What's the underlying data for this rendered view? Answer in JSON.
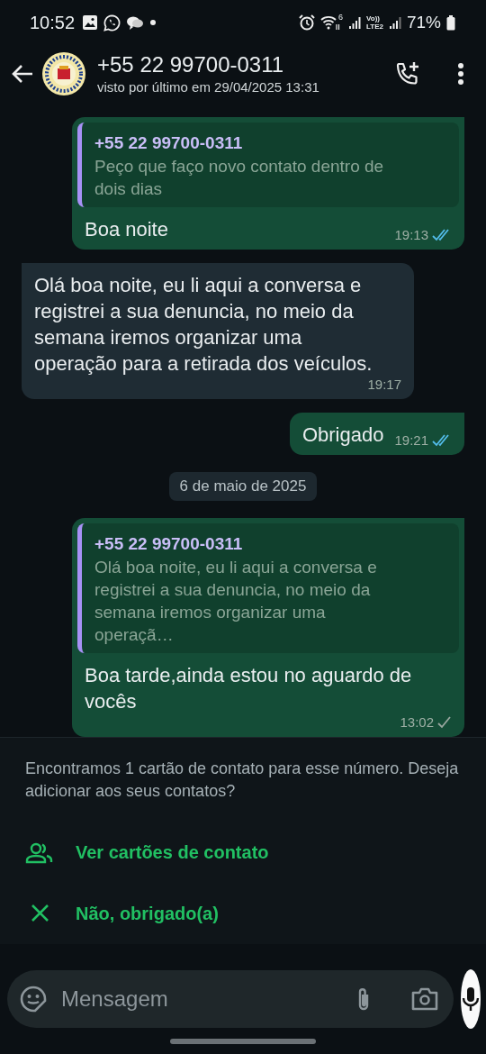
{
  "status_bar": {
    "time": "10:52",
    "volte": [
      "Vo))",
      "LTE2"
    ],
    "wifi_label": "6",
    "battery": "71%"
  },
  "header": {
    "name": "+55 22 99700-0311",
    "last_seen": "visto por último em 29/04/2025 13:31"
  },
  "messages": [
    {
      "kind": "message",
      "outgoing": true,
      "quote": {
        "author": "+55 22 99700-0311",
        "text": "Peço que faço novo contato dentro de dois dias"
      },
      "text": "Boa noite",
      "time": "19:13",
      "read": true
    },
    {
      "kind": "message",
      "outgoing": false,
      "text": "Olá boa noite, eu li aqui a conversa e registrei a sua denuncia, no meio da semana iremos organizar uma operação para a retirada dos veículos.",
      "time": "19:17"
    },
    {
      "kind": "message",
      "outgoing": true,
      "text": "Obrigado",
      "time": "19:21",
      "read": true
    },
    {
      "kind": "date",
      "text": "6 de maio de 2025"
    },
    {
      "kind": "message",
      "outgoing": true,
      "quote": {
        "author": "+55 22 99700-0311",
        "text": "Olá boa noite, eu li aqui a conversa e registrei a sua denuncia, no meio da semana iremos organizar uma operaçã…"
      },
      "text": "Boa tarde,ainda estou no aguardo de vocês",
      "time": "13:02",
      "read": false
    }
  ],
  "contact_prompt": {
    "text": "Encontramos 1 cartão de contato para esse número. Deseja adicionar aos seus contatos?",
    "actions": [
      {
        "kind": "view",
        "label": "Ver cartões de contato"
      },
      {
        "kind": "dismiss",
        "label": "Não, obrigado(a)"
      }
    ]
  },
  "composer": {
    "placeholder": "Mensagem"
  }
}
